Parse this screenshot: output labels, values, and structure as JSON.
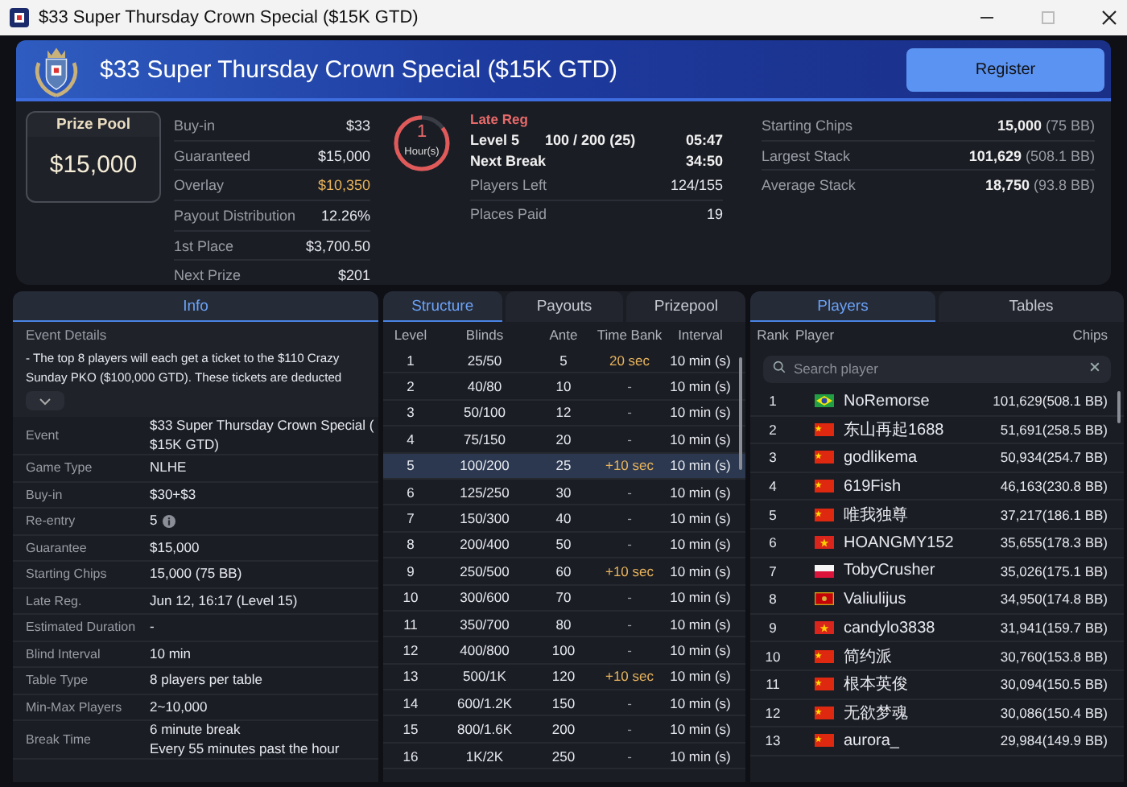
{
  "window": {
    "title": "$33 Super Thursday Crown Special ($15K GTD)"
  },
  "banner": {
    "title": "$33 Super Thursday Crown Special ($15K GTD)",
    "register_button": "Register"
  },
  "prize_pool": {
    "label": "Prize Pool",
    "amount": "$15,000"
  },
  "summary": [
    {
      "label": "Buy-in",
      "value": "$33",
      "highlight": false
    },
    {
      "label": "Guaranteed",
      "value": "$15,000",
      "highlight": false
    },
    {
      "label": "Overlay",
      "value": "$10,350",
      "highlight": true
    },
    {
      "label": "Payout Distribution",
      "value": "12.26%",
      "highlight": false
    },
    {
      "label": "1st Place",
      "value": "$3,700.50",
      "highlight": false
    },
    {
      "label": "Next Prize",
      "value": "$201",
      "highlight": false
    }
  ],
  "late_reg": {
    "label": "Late Reg",
    "timer_value": "1",
    "timer_unit": "Hour(s)",
    "level": 0.85,
    "level_label": "Level 5",
    "blinds": "100 / 200 (25)",
    "level_time": "05:47",
    "break_label": "Next Break",
    "break_time": "34:50"
  },
  "progress": [
    {
      "label": "Players Left",
      "value": "124/155"
    },
    {
      "label": "Places Paid",
      "value": "19"
    }
  ],
  "stacks": [
    {
      "label": "Starting Chips",
      "value": "15,000",
      "bb": "(75 BB)"
    },
    {
      "label": "Largest Stack",
      "value": "101,629",
      "bb": "(508.1 BB)"
    },
    {
      "label": "Average Stack",
      "value": "18,750",
      "bb": "(93.8 BB)"
    }
  ],
  "info": {
    "tab": {
      "label": "Info",
      "selected": true
    },
    "details_heading": "Event Details",
    "description": "- The top 8 players will each get a ticket to the $110 Crazy Sunday PKO ($100,000 GTD). These tickets are deducted",
    "rows": [
      {
        "label": "Event",
        "lines": [
          "$33 Super Thursday Crown Special (",
          "$15K GTD)"
        ],
        "info_icon": false
      },
      {
        "label": "Game Type",
        "lines": [
          "NLHE"
        ],
        "info_icon": false
      },
      {
        "label": "Buy-in",
        "lines": [
          "$30+$3"
        ],
        "info_icon": false
      },
      {
        "label": "Re-entry",
        "lines": [
          "5"
        ],
        "info_icon": true
      },
      {
        "label": "Guarantee",
        "lines": [
          "$15,000"
        ],
        "info_icon": false
      },
      {
        "label": "Starting Chips",
        "lines": [
          "15,000 (75 BB)"
        ],
        "info_icon": false
      },
      {
        "label": "Late Reg.",
        "lines": [
          "Jun 12, 16:17 (Level 15)"
        ],
        "info_icon": false
      },
      {
        "label": "Estimated Duration",
        "lines": [
          "-"
        ],
        "info_icon": false
      },
      {
        "label": "Blind Interval",
        "lines": [
          "10 min"
        ],
        "info_icon": false
      },
      {
        "label": "Table Type",
        "lines": [
          "8 players per table"
        ],
        "info_icon": false
      },
      {
        "label": "Min-Max Players",
        "lines": [
          "2~10,000"
        ],
        "info_icon": false
      },
      {
        "label": "Break Time",
        "lines": [
          "6 minute break",
          "Every 55 minutes past the hour"
        ],
        "info_icon": false
      }
    ]
  },
  "structure": {
    "tabs": [
      {
        "label": "Structure",
        "selected": true
      },
      {
        "label": "Payouts",
        "selected": false
      },
      {
        "label": "Prizepool",
        "selected": false
      }
    ],
    "columns": [
      "Level",
      "Blinds",
      "Ante",
      "Time Bank",
      "Interval"
    ],
    "rows": [
      {
        "level": "1",
        "blinds": "25/50",
        "ante": "5",
        "time_bank": "20 sec",
        "bonus": true,
        "interval": "10 min (s)",
        "selected": false
      },
      {
        "level": "2",
        "blinds": "40/80",
        "ante": "10",
        "time_bank": "-",
        "bonus": false,
        "interval": "10 min (s)",
        "selected": false
      },
      {
        "level": "3",
        "blinds": "50/100",
        "ante": "12",
        "time_bank": "-",
        "bonus": false,
        "interval": "10 min (s)",
        "selected": false
      },
      {
        "level": "4",
        "blinds": "75/150",
        "ante": "20",
        "time_bank": "-",
        "bonus": false,
        "interval": "10 min (s)",
        "selected": false
      },
      {
        "level": "5",
        "blinds": "100/200",
        "ante": "25",
        "time_bank": "+10 sec",
        "bonus": true,
        "interval": "10 min (s)",
        "selected": true
      },
      {
        "level": "6",
        "blinds": "125/250",
        "ante": "30",
        "time_bank": "-",
        "bonus": false,
        "interval": "10 min (s)",
        "selected": false
      },
      {
        "level": "7",
        "blinds": "150/300",
        "ante": "40",
        "time_bank": "-",
        "bonus": false,
        "interval": "10 min (s)",
        "selected": false
      },
      {
        "level": "8",
        "blinds": "200/400",
        "ante": "50",
        "time_bank": "-",
        "bonus": false,
        "interval": "10 min (s)",
        "selected": false
      },
      {
        "level": "9",
        "blinds": "250/500",
        "ante": "60",
        "time_bank": "+10 sec",
        "bonus": true,
        "interval": "10 min (s)",
        "selected": false
      },
      {
        "level": "10",
        "blinds": "300/600",
        "ante": "70",
        "time_bank": "-",
        "bonus": false,
        "interval": "10 min (s)",
        "selected": false
      },
      {
        "level": "11",
        "blinds": "350/700",
        "ante": "80",
        "time_bank": "-",
        "bonus": false,
        "interval": "10 min (s)",
        "selected": false
      },
      {
        "level": "12",
        "blinds": "400/800",
        "ante": "100",
        "time_bank": "-",
        "bonus": false,
        "interval": "10 min (s)",
        "selected": false
      },
      {
        "level": "13",
        "blinds": "500/1K",
        "ante": "120",
        "time_bank": "+10 sec",
        "bonus": true,
        "interval": "10 min (s)",
        "selected": false
      },
      {
        "level": "14",
        "blinds": "600/1.2K",
        "ante": "150",
        "time_bank": "-",
        "bonus": false,
        "interval": "10 min (s)",
        "selected": false
      },
      {
        "level": "15",
        "blinds": "800/1.6K",
        "ante": "200",
        "time_bank": "-",
        "bonus": false,
        "interval": "10 min (s)",
        "selected": false
      },
      {
        "level": "16",
        "blinds": "1K/2K",
        "ante": "250",
        "time_bank": "-",
        "bonus": false,
        "interval": "10 min (s)",
        "selected": false
      }
    ]
  },
  "players": {
    "tabs": [
      {
        "label": "Players",
        "selected": true
      },
      {
        "label": "Tables",
        "selected": false
      }
    ],
    "columns": [
      "Rank",
      "Player",
      "Chips"
    ],
    "search": {
      "placeholder": "Search player"
    },
    "rows": [
      {
        "rank": "1",
        "kind": "br",
        "name": "NoRemorse",
        "chips": "101,629(508.1 BB)"
      },
      {
        "rank": "2",
        "kind": "cn",
        "name": "东山再起1688",
        "chips": "51,691(258.5 BB)"
      },
      {
        "rank": "3",
        "kind": "cn",
        "name": "godlikema",
        "chips": "50,934(254.7 BB)"
      },
      {
        "rank": "4",
        "kind": "cn",
        "name": "619Fish",
        "chips": "46,163(230.8 BB)"
      },
      {
        "rank": "5",
        "kind": "cn",
        "name": "唯我独尊",
        "chips": "37,217(186.1 BB)"
      },
      {
        "rank": "6",
        "kind": "vn",
        "name": "HOANGMY152",
        "chips": "35,655(178.3 BB)"
      },
      {
        "rank": "7",
        "kind": "pl",
        "name": "TobyCrusher",
        "chips": "35,026(175.1 BB)"
      },
      {
        "rank": "8",
        "kind": "me",
        "name": "Valiulijus",
        "chips": "34,950(174.8 BB)"
      },
      {
        "rank": "9",
        "kind": "vn",
        "name": "candylo3838",
        "chips": "31,941(159.7 BB)"
      },
      {
        "rank": "10",
        "kind": "cn",
        "name": "简约派",
        "chips": "30,760(153.8 BB)"
      },
      {
        "rank": "11",
        "kind": "cn",
        "name": "根本英俊",
        "chips": "30,094(150.5 BB)"
      },
      {
        "rank": "12",
        "kind": "cn",
        "name": "无欲梦魂",
        "chips": "30,086(150.4 BB)"
      },
      {
        "rank": "13",
        "kind": "cn",
        "name": "aurora_",
        "chips": "29,984(149.9 BB)"
      }
    ]
  }
}
